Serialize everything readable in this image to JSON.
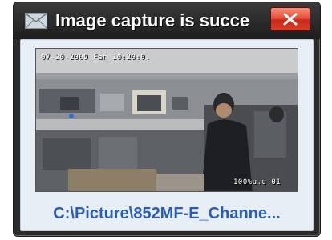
{
  "notification": {
    "title": "Image capture is succe",
    "icons": {
      "mail": "envelope-icon",
      "close": "close-icon"
    },
    "preview": {
      "osd_top": "07-20-2009 Fan 10:20:0.",
      "osd_bottom": "100%u.u 01"
    },
    "file_link": "C:\\Picture\\852MF-E_Channe..."
  },
  "colors": {
    "titlebar": "#1e1e1e",
    "close_button": "#d8402a",
    "body_background": "#e8eef6",
    "link": "#2a5cb8"
  }
}
